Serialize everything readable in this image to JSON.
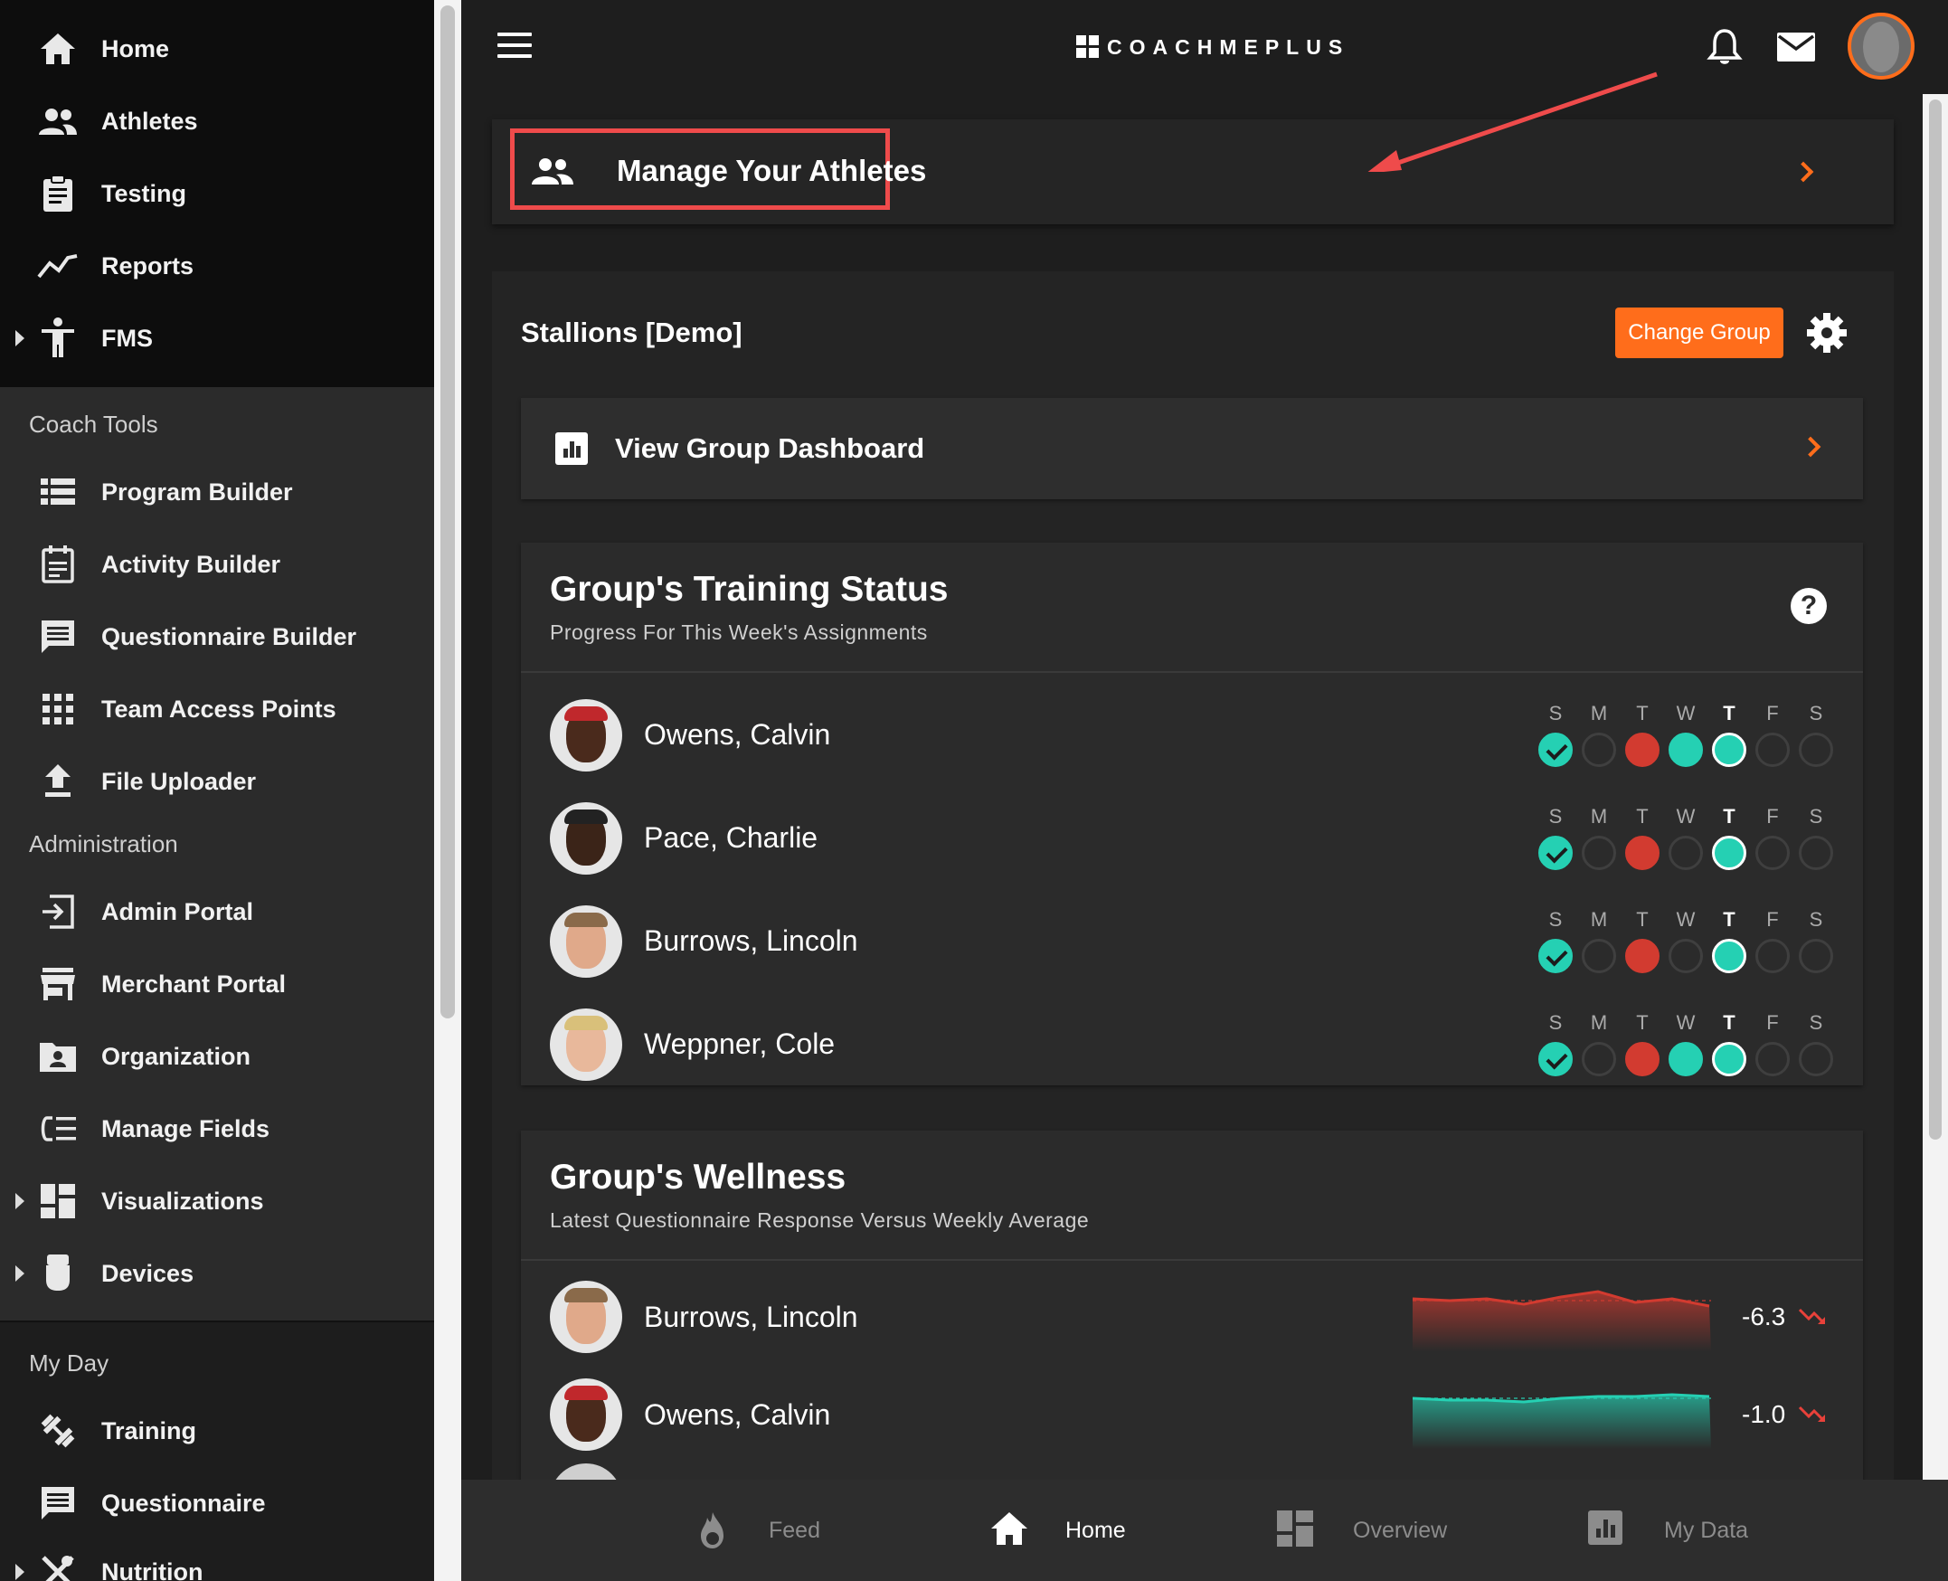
{
  "sidebar": {
    "main_items": [
      {
        "label": "Home",
        "icon": "home-icon"
      },
      {
        "label": "Athletes",
        "icon": "people-icon"
      },
      {
        "label": "Testing",
        "icon": "clipboard-icon"
      },
      {
        "label": "Reports",
        "icon": "trend-line-icon"
      },
      {
        "label": "FMS",
        "icon": "person-accessibility-icon"
      }
    ],
    "coach_tools_header": "Coach Tools",
    "coach_tools": [
      {
        "label": "Program Builder",
        "icon": "list-icon"
      },
      {
        "label": "Activity Builder",
        "icon": "calendar-note-icon"
      },
      {
        "label": "Questionnaire Builder",
        "icon": "chat-box-icon"
      },
      {
        "label": "Team Access Points",
        "icon": "grid-icon"
      },
      {
        "label": "File Uploader",
        "icon": "upload-icon"
      }
    ],
    "administration_header": "Administration",
    "administration": [
      {
        "label": "Admin Portal",
        "icon": "sign-in-icon"
      },
      {
        "label": "Merchant Portal",
        "icon": "store-icon"
      },
      {
        "label": "Organization",
        "icon": "folder-person-icon"
      },
      {
        "label": "Manage Fields",
        "icon": "fields-icon"
      },
      {
        "label": "Visualizations",
        "icon": "dashboard-icon"
      },
      {
        "label": "Devices",
        "icon": "device-icon"
      }
    ],
    "my_day_header": "My Day",
    "my_day": [
      {
        "label": "Training",
        "icon": "dumbbell-icon"
      },
      {
        "label": "Questionnaire",
        "icon": "chat-box-icon"
      },
      {
        "label": "Nutrition",
        "icon": "utensils-icon"
      }
    ]
  },
  "topbar": {
    "logo_text": "COACHMEPLUS"
  },
  "manage": {
    "label": "Manage Your Athletes"
  },
  "group": {
    "title": "Stallions [Demo]",
    "change_group_label": "Change Group",
    "dashboard_label": "View Group Dashboard"
  },
  "training": {
    "title": "Group's Training Status",
    "subtitle": "Progress For This Week's Assignments",
    "help_label": "?",
    "day_letters": [
      "S",
      "M",
      "T",
      "W",
      "T",
      "F",
      "S"
    ],
    "athletes": [
      {
        "name": "Owens, Calvin",
        "days": [
          "check",
          "empty",
          "miss",
          "done",
          "today",
          "empty",
          "empty"
        ]
      },
      {
        "name": "Pace, Charlie",
        "days": [
          "check",
          "empty",
          "miss",
          "empty",
          "today",
          "empty",
          "empty"
        ]
      },
      {
        "name": "Burrows, Lincoln",
        "days": [
          "check",
          "empty",
          "miss",
          "empty",
          "today",
          "empty",
          "empty"
        ]
      },
      {
        "name": "Weppner, Cole",
        "days": [
          "check",
          "empty",
          "miss",
          "done",
          "today",
          "empty",
          "empty"
        ]
      }
    ]
  },
  "wellness": {
    "title": "Group's Wellness",
    "subtitle": "Latest Questionnaire Response Versus Weekly Average",
    "athletes": [
      {
        "name": "Burrows, Lincoln",
        "value": "-6.3",
        "color": "#d23b30"
      },
      {
        "name": "Owens, Calvin",
        "value": "-1.0",
        "color": "#25d0b3"
      }
    ]
  },
  "bottom_nav": [
    {
      "label": "Feed",
      "icon": "flame-icon"
    },
    {
      "label": "Home",
      "icon": "home-icon",
      "active": true
    },
    {
      "label": "Overview",
      "icon": "dashboard-icon"
    },
    {
      "label": "My Data",
      "icon": "bar-chart-icon"
    }
  ],
  "colors": {
    "accent": "#ff6d1b",
    "highlight": "#ef4b4b",
    "done": "#25d0b3",
    "missed": "#d23b30"
  }
}
